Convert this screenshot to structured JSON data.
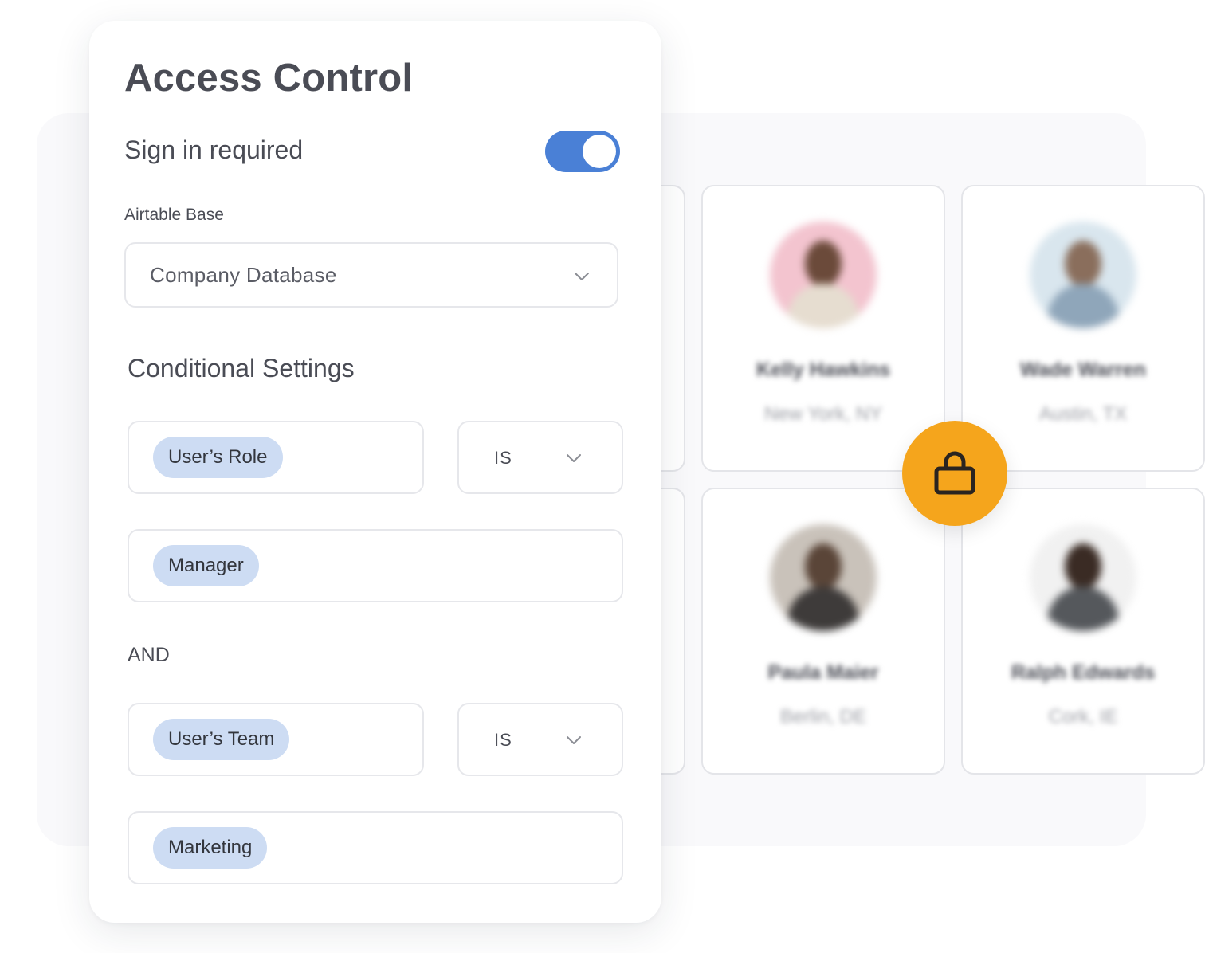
{
  "access_control": {
    "title": "Access Control",
    "sign_in": {
      "label": "Sign in required",
      "enabled": true
    },
    "airtable_base": {
      "label": "Airtable Base",
      "selected": "Company Database"
    },
    "conditional_settings": {
      "title": "Conditional Settings",
      "joiner": "AND",
      "conditions": [
        {
          "field": "User’s Role",
          "operator": "IS",
          "value": "Manager"
        },
        {
          "field": "User’s Team",
          "operator": "IS",
          "value": "Marketing"
        }
      ]
    }
  },
  "profiles": [
    {
      "name": "Kelly Hawkins",
      "location": "New York, NY"
    },
    {
      "name": "Wade Warren",
      "location": "Austin, TX"
    },
    {
      "name": "Paula Maier",
      "location": "Berlin, DE"
    },
    {
      "name": "Ralph Edwards",
      "location": "Cork, IE"
    }
  ],
  "lock_badge": {
    "icon": "lock-icon",
    "color": "#f5a51c"
  },
  "colors": {
    "accent": "#4a80d6",
    "chip": "#cddcf3",
    "lock": "#f5a51c",
    "text": "#4a4c55"
  }
}
